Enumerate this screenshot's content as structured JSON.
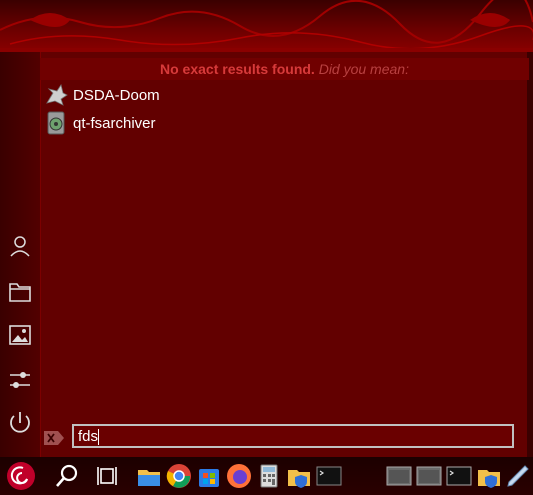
{
  "message": {
    "bold": "No exact results found.",
    "italic": "Did you mean:"
  },
  "results": [
    {
      "label": "DSDA-Doom",
      "icon": "doom-icon"
    },
    {
      "label": "qt-fsarchiver",
      "icon": "fsarchiver-icon"
    }
  ],
  "search": {
    "value": "fds"
  },
  "sidebar": {
    "items": [
      {
        "icon": "user-icon"
      },
      {
        "icon": "folder-icon"
      },
      {
        "icon": "pictures-icon"
      },
      {
        "icon": "settings-icon"
      },
      {
        "icon": "power-icon"
      }
    ]
  },
  "colors": {
    "panel": "#620000",
    "accent": "#d73a3a",
    "text": "#ffffff"
  }
}
